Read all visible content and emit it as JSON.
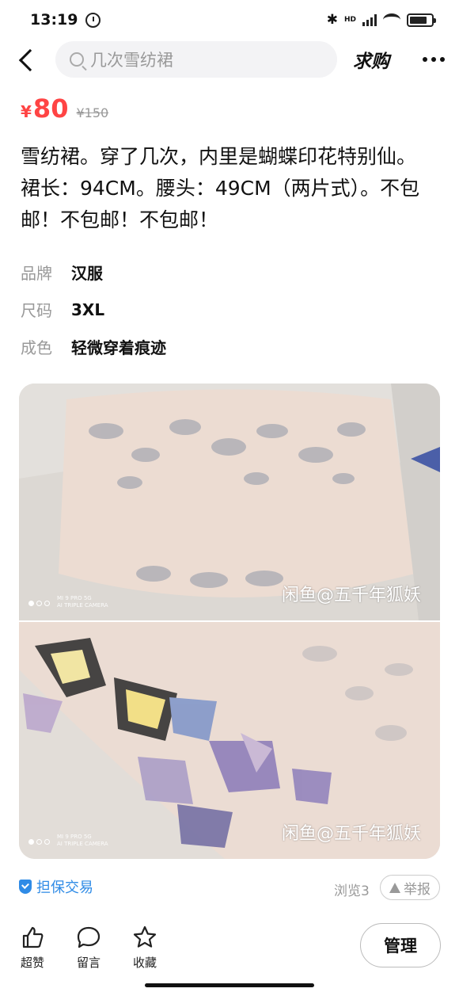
{
  "status": {
    "time": "13:19",
    "net": "HD"
  },
  "nav": {
    "search_placeholder": "几次雪纺裙",
    "qiugou": "求购"
  },
  "price": {
    "symbol": "¥",
    "value": "80",
    "original": "¥150"
  },
  "description": "雪纺裙。穿了几次，内里是蝴蝶印花特别仙。裙长：94CM。腰头：49CM（两片式）。不包邮！不包邮！不包邮！",
  "attributes": [
    {
      "key": "品牌",
      "value": "汉服"
    },
    {
      "key": "尺码",
      "value": "3XL"
    },
    {
      "key": "成色",
      "value": "轻微穿着痕迹"
    }
  ],
  "photos": [
    {
      "watermark": "闲鱼@五千年狐妖",
      "camera": "MI 9 PRO 5G\nAI TRIPLE CAMERA"
    },
    {
      "watermark": "闲鱼@五千年狐妖",
      "camera": "MI 9 PRO 5G\nAI TRIPLE CAMERA"
    }
  ],
  "meta": {
    "guarantee": "担保交易",
    "views": "浏览3",
    "report": "举报"
  },
  "bottom": {
    "like": "超赞",
    "comment": "留言",
    "favorite": "收藏",
    "manage": "管理"
  },
  "colors": {
    "price": "#ff4444",
    "guarantee": "#2f8be6"
  }
}
